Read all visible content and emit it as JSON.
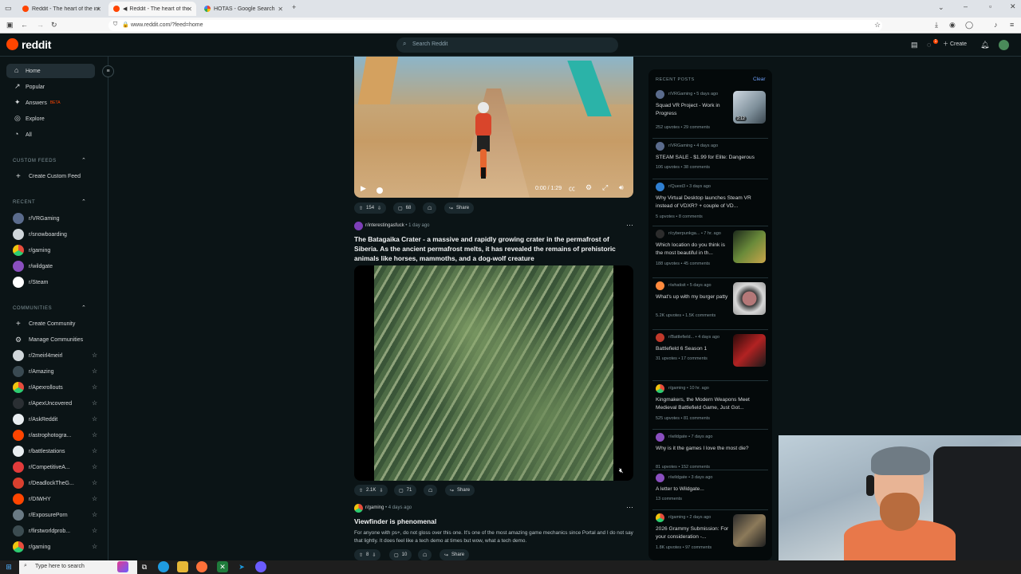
{
  "browser": {
    "tabs": [
      {
        "title": "Reddit - The heart of the interne"
      },
      {
        "title": "Reddit - The heart of the in"
      },
      {
        "title": "HOTAS - Google Search"
      }
    ],
    "url": "www.reddit.com/?feed=home",
    "new_tab": "+"
  },
  "header": {
    "logo": "reddit",
    "search_placeholder": "Search Reddit",
    "create_label": "Create",
    "chat_badge": "1"
  },
  "sidebar": {
    "nav": [
      {
        "label": "Home",
        "icon": "home-icon"
      },
      {
        "label": "Popular",
        "icon": "popular-icon"
      },
      {
        "label": "Answers",
        "icon": "answers-icon",
        "badge": "BETA"
      },
      {
        "label": "Explore",
        "icon": "explore-icon"
      },
      {
        "label": "All",
        "icon": "all-icon"
      }
    ],
    "custom_feeds_title": "CUSTOM FEEDS",
    "create_custom_feed": "Create Custom Feed",
    "recent_title": "RECENT",
    "recent": [
      "r/VRGaming",
      "r/snowboarding",
      "r/gaming",
      "r/wildgate",
      "r/Steam"
    ],
    "communities_title": "COMMUNITIES",
    "create_community": "Create Community",
    "manage_communities": "Manage Communities",
    "communities": [
      "r/2meirl4meirl",
      "r/Amazing",
      "r/Apexrollouts",
      "r/ApexUncovered",
      "r/AskReddit",
      "r/astrophotogra...",
      "r/battlestations",
      "r/CompetitiveA...",
      "r/DeadlockTheG...",
      "r/DIWHY",
      "r/ExposurePorn",
      "r/firstworldprob...",
      "r/gaming"
    ]
  },
  "feed": {
    "post1": {
      "timecode": "0:00 / 1:29",
      "votes": "154",
      "comments": "68",
      "share": "Share"
    },
    "post2": {
      "subreddit": "r/interestingasfuck",
      "age": "1 day ago",
      "title": "The Batagaika Crater - a massive and rapidly growing crater in the permafrost of Siberia. As the ancient permafrost melts, it has revealed the remains of prehistoric animals like horses, mammoths, and a dog-wolf creature",
      "votes": "2.1K",
      "comments": "71",
      "share": "Share"
    },
    "post3": {
      "subreddit": "r/gaming",
      "age": "4 days ago",
      "title": "Viewfinder is phenomenal",
      "body": "For anyone with ps+, do not gloss over this one. It's one of the most amazing game mechanics since Portal and I do not say that lightly. It does feel like a tech demo at times but wow, what a tech demo.",
      "votes": "8",
      "comments": "10",
      "share": "Share"
    }
  },
  "recent_posts": {
    "title": "RECENT POSTS",
    "clear": "Clear",
    "items": [
      {
        "sub": "r/VRGaming",
        "age": "5 days ago",
        "title": "Squad VR Project - Work in Progress",
        "upvotes": "252 upvotes",
        "comments": "29 comments",
        "thumb": "video-thumb",
        "thumb_time": "2:12"
      },
      {
        "sub": "r/VRGaming",
        "age": "4 days ago",
        "title": "STEAM SALE - $1.99 for Elite: Dangerous",
        "upvotes": "106 upvotes",
        "comments": "38 comments"
      },
      {
        "sub": "r/Quest3",
        "age": "3 days ago",
        "title": "Why Virtual Desktop launches Steam VR instead of VDXR? + couple of VD...",
        "upvotes": "5 upvotes",
        "comments": "8 comments"
      },
      {
        "sub": "r/cyberpunkga...",
        "age": "7 hr. ago",
        "title": "Which location do you think is the most beautiful in th...",
        "upvotes": "188 upvotes",
        "comments": "45 comments"
      },
      {
        "sub": "r/whatisit",
        "age": "5 days ago",
        "title": "What's up with my burger patty",
        "upvotes": "5.2K upvotes",
        "comments": "1.5K comments"
      },
      {
        "sub": "r/Battlefield...",
        "age": "4 days ago",
        "title": "Battlefield 6 Season 1",
        "upvotes": "31 upvotes",
        "comments": "17 comments"
      },
      {
        "sub": "r/gaming",
        "age": "10 hr. ago",
        "title": "Kingmakers, the Modern Weapons Meet Medieval Battlefield Game, Just Got...",
        "upvotes": "525 upvotes",
        "comments": "81 comments"
      },
      {
        "sub": "r/wildgate",
        "age": "7 days ago",
        "title": "Why is it the games I love the most die?",
        "upvotes": "81 upvotes",
        "comments": "152 comments"
      },
      {
        "sub": "r/wildgate",
        "age": "3 days ago",
        "title": "A letter to Wildgate...",
        "upvotes": "",
        "comments": "13 comments"
      },
      {
        "sub": "r/gaming",
        "age": "2 days ago",
        "title": "2026 Grammy Submission: For your consideration -...",
        "upvotes": "1.8K upvotes",
        "comments": "97 comments"
      }
    ]
  },
  "taskbar": {
    "search_placeholder": "Type here to search"
  }
}
